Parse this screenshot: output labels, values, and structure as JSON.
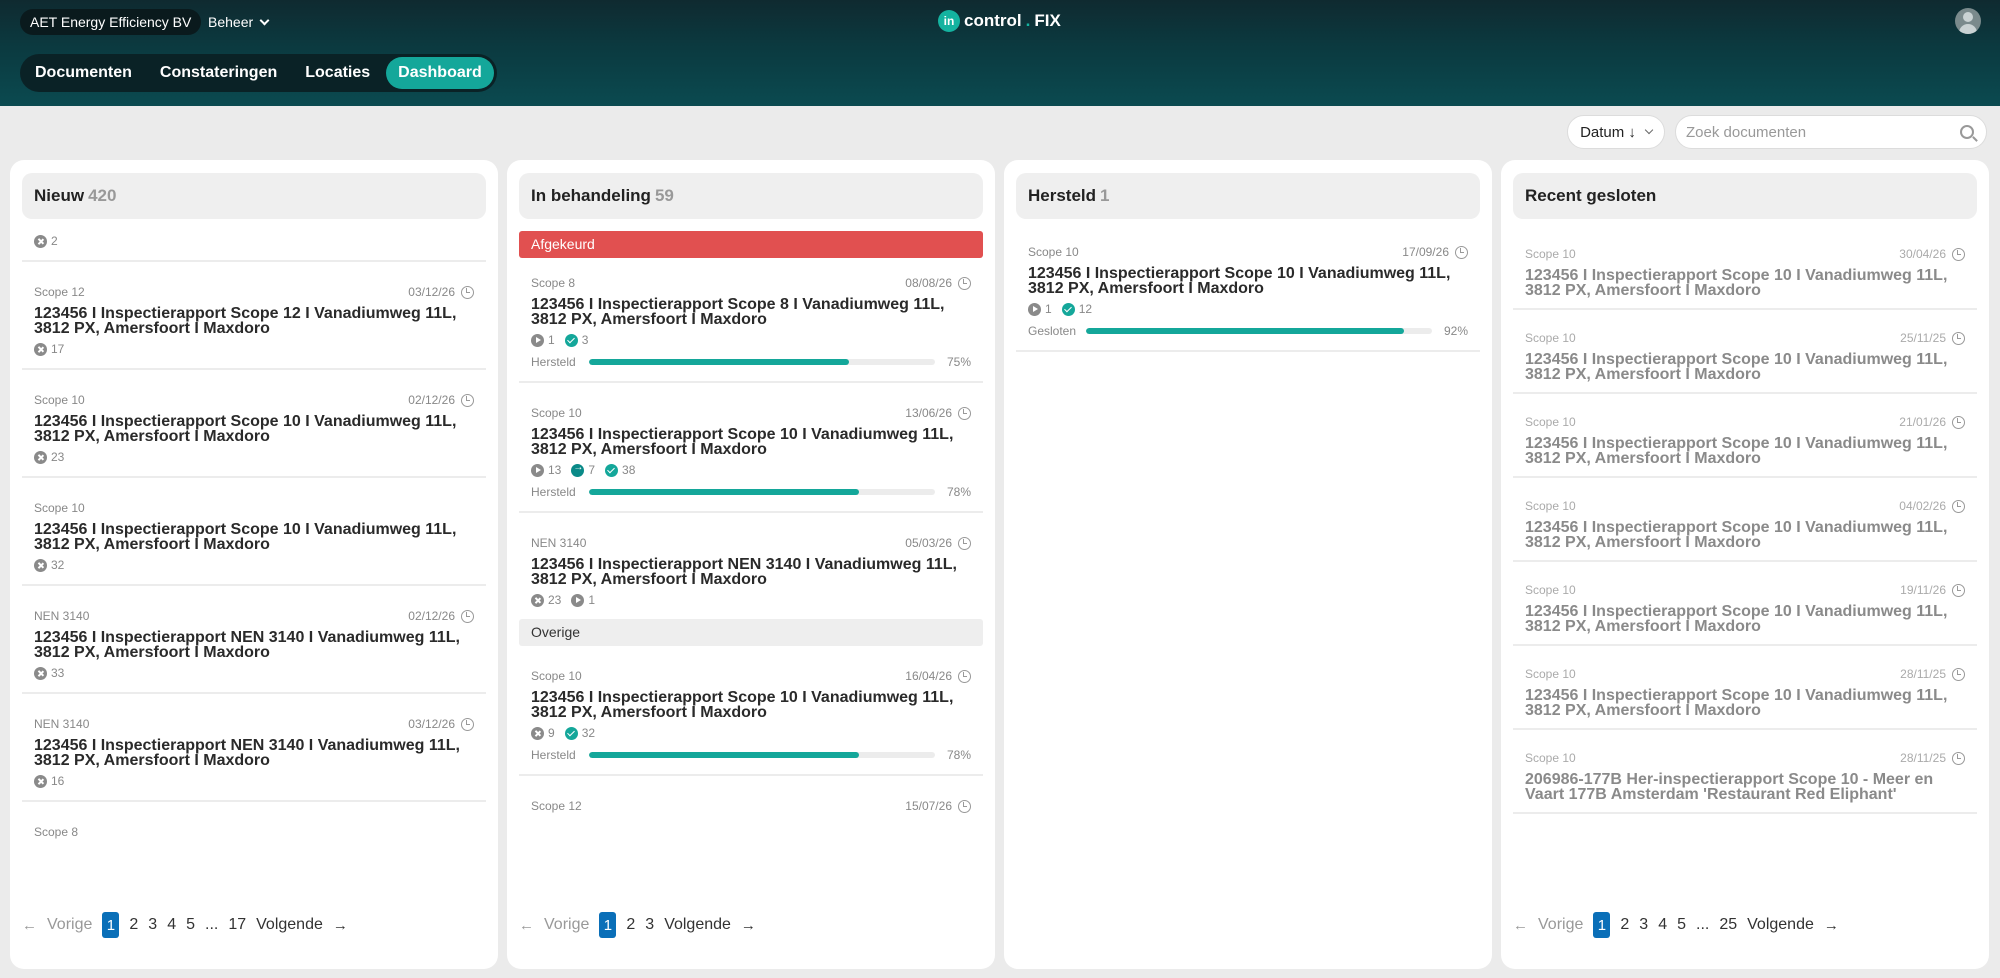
{
  "header": {
    "org": "AET Energy Efficiency BV",
    "beheer": "Beheer",
    "logo_mark": "in",
    "logo_text_1": "control",
    "logo_dot": ".",
    "logo_text_2": "FIX"
  },
  "nav": {
    "items": [
      {
        "label": "Documenten"
      },
      {
        "label": "Constateringen"
      },
      {
        "label": "Locaties"
      },
      {
        "label": "Dashboard"
      }
    ]
  },
  "toolbar": {
    "sort_label": "Datum ↓",
    "search_placeholder": "Zoek documenten"
  },
  "columns": {
    "nieuw": {
      "title": "Nieuw",
      "count": "420",
      "stub_count": "2",
      "cards": [
        {
          "scope": "Scope 12",
          "date": "03/12/26",
          "title": "123456 I Inspectierapport Scope 12 I Vanadiumweg 11L, 3812 PX, Amersfoort I Maxdoro",
          "cancel": "17"
        },
        {
          "scope": "Scope 10",
          "date": "02/12/26",
          "title": "123456 I Inspectierapport Scope 10 I Vanadiumweg 11L, 3812 PX, Amersfoort I Maxdoro",
          "cancel": "23"
        },
        {
          "scope": "Scope 10",
          "date": "",
          "title": "123456 I Inspectierapport Scope 10 I Vanadiumweg 11L, 3812 PX, Amersfoort I Maxdoro",
          "cancel": "32"
        },
        {
          "scope": "NEN 3140",
          "date": "02/12/26",
          "title": "123456 I Inspectierapport NEN 3140 I Vanadiumweg 11L, 3812 PX, Amersfoort I Maxdoro",
          "cancel": "33"
        },
        {
          "scope": "NEN 3140",
          "date": "03/12/26",
          "title": "123456 I Inspectierapport NEN 3140 I Vanadiumweg 11L, 3812 PX, Amersfoort I Maxdoro",
          "cancel": "16"
        },
        {
          "scope": "Scope 8",
          "date": "",
          "title": "",
          "cancel": ""
        }
      ],
      "pager": {
        "prev": "Vorige",
        "pages": [
          "1",
          "2",
          "3",
          "4",
          "5",
          "...",
          "17"
        ],
        "next": "Volgende"
      }
    },
    "behandeling": {
      "title": "In behandeling",
      "count": "59",
      "section_afgekeurd": "Afgekeurd",
      "section_overige": "Overige",
      "cards": [
        {
          "scope": "Scope 8",
          "date": "08/08/26",
          "title": "123456 I Inspectierapport Scope 8 I Vanadiumweg 11L, 3812 PX, Amersfoort I Maxdoro",
          "play": "1",
          "check": "3",
          "plabel": "Hersteld",
          "pct": "75%",
          "progress": 0.75
        },
        {
          "scope": "Scope 10",
          "date": "13/06/26",
          "title": "123456 I Inspectierapport Scope 10 I Vanadiumweg 11L, 3812 PX, Amersfoort I Maxdoro",
          "play": "13",
          "forward": "7",
          "check": "38",
          "plabel": "Hersteld",
          "pct": "78%",
          "progress": 0.78
        },
        {
          "scope": "NEN 3140",
          "date": "05/03/26",
          "title": "123456 I Inspectierapport NEN 3140 I Vanadiumweg 11L, 3812 PX, Amersfoort I Maxdoro",
          "cancel": "23",
          "play": "1"
        },
        {
          "scope": "Scope 10",
          "date": "16/04/26",
          "title": "123456 I Inspectierapport Scope 10 I Vanadiumweg 11L, 3812 PX, Amersfoort I Maxdoro",
          "cancel": "9",
          "check": "32",
          "plabel": "Hersteld",
          "pct": "78%",
          "progress": 0.78
        },
        {
          "scope": "Scope 12",
          "date": "15/07/26"
        }
      ],
      "pager": {
        "prev": "Vorige",
        "pages": [
          "1",
          "2",
          "3"
        ],
        "next": "Volgende"
      }
    },
    "hersteld": {
      "title": "Hersteld",
      "count": "1",
      "cards": [
        {
          "scope": "Scope 10",
          "date": "17/09/26",
          "title": "123456 I Inspectierapport Scope 10 I Vanadiumweg 11L, 3812 PX, Amersfoort I Maxdoro",
          "forward": "1",
          "check": "12",
          "plabel": "Gesloten",
          "pct": "92%",
          "progress": 0.92
        }
      ]
    },
    "gesloten": {
      "title": "Recent gesloten",
      "cards": [
        {
          "scope": "Scope 10",
          "date": "30/04/26",
          "title": "123456 I Inspectierapport Scope 10 I Vanadiumweg 11L, 3812 PX, Amersfoort I Maxdoro"
        },
        {
          "scope": "Scope 10",
          "date": "25/11/25",
          "title": "123456 I Inspectierapport Scope 10 I Vanadiumweg 11L, 3812 PX, Amersfoort I Maxdoro"
        },
        {
          "scope": "Scope 10",
          "date": "21/01/26",
          "title": "123456 I Inspectierapport Scope 10 I Vanadiumweg 11L, 3812 PX, Amersfoort I Maxdoro"
        },
        {
          "scope": "Scope 10",
          "date": "04/02/26",
          "title": "123456 I Inspectierapport Scope 10 I Vanadiumweg 11L, 3812 PX, Amersfoort I Maxdoro"
        },
        {
          "scope": "Scope 10",
          "date": "19/11/26",
          "title": "123456 I Inspectierapport Scope 10 I Vanadiumweg 11L, 3812 PX, Amersfoort I Maxdoro"
        },
        {
          "scope": "Scope 10",
          "date": "28/11/25",
          "title": "123456 I Inspectierapport Scope 10 I Vanadiumweg 11L, 3812 PX, Amersfoort I Maxdoro"
        },
        {
          "scope": "Scope 10",
          "date": "28/11/25",
          "title": "206986-177B Her-inspectierapport Scope 10 - Meer en Vaart 177B Amsterdam 'Restaurant Red Eliphant'"
        }
      ],
      "pager": {
        "prev": "Vorige",
        "pages": [
          "1",
          "2",
          "3",
          "4",
          "5",
          "...",
          "25"
        ],
        "next": "Volgende"
      }
    }
  },
  "colors": {
    "accent": "#14a79a",
    "danger": "#e15050",
    "page_active": "#0a6fb8"
  }
}
